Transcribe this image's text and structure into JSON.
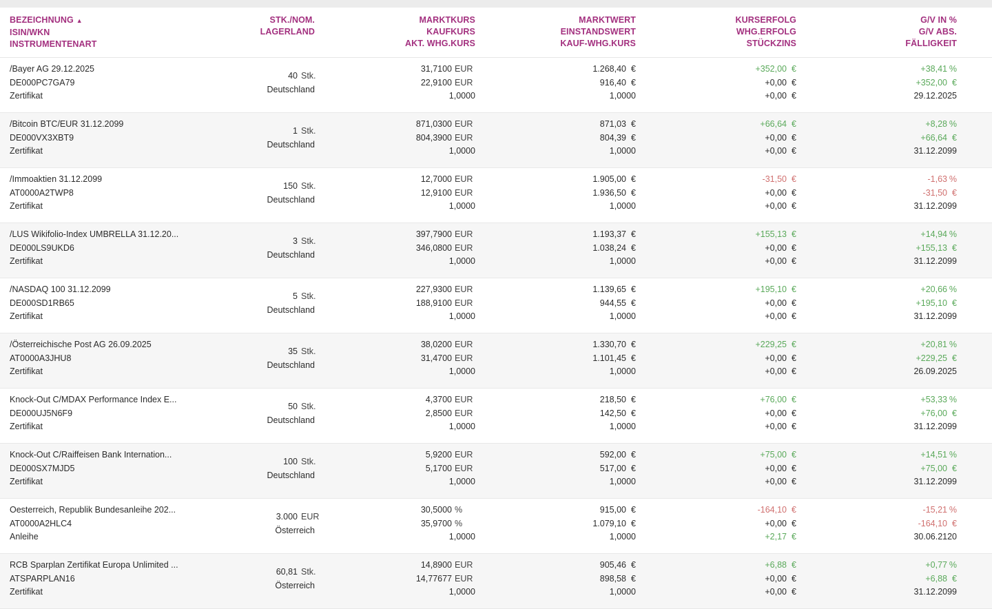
{
  "header": {
    "col1": [
      "BEZEICHNUNG",
      "ISIN/WKN",
      "INSTRUMENTENART"
    ],
    "col2": [
      "STK./NOM.",
      "LAGERLAND"
    ],
    "col3": [
      "MARKTKURS",
      "KAUFKURS",
      "AKT. WHG.KURS"
    ],
    "col4": [
      "MARKTWERT",
      "EINSTANDSWERT",
      "KAUF-WHG.KURS"
    ],
    "col5": [
      "KURSERFOLG",
      "WHG.ERFOLG",
      "STÜCKZINS"
    ],
    "col6": [
      "G/V IN %",
      "G/V ABS.",
      "FÄLLIGKEIT"
    ],
    "sort_icon": "sort-up-icon"
  },
  "colors": {
    "accent": "#a3307f",
    "positive": "#5aa95a",
    "negative": "#d0706f"
  },
  "rows": [
    {
      "name": "/Bayer AG 29.12.2025",
      "isin": "DE000PC7GA79",
      "type": "Zertifikat",
      "qty": "40",
      "qty_unit": "Stk.",
      "country": "Deutschland",
      "mkt": "31,7100",
      "mkt_unit": "EUR",
      "buy": "22,9100",
      "buy_unit": "EUR",
      "fx": "1,0000",
      "mval": "1.268,40",
      "cost": "916,40",
      "buyfx": "1,0000",
      "perf": "+352,00",
      "perf_sign": "pos",
      "fxperf": "+0,00",
      "accr": "+0,00",
      "accr_sign": "",
      "pct": "+38,41",
      "pct_sign": "pos",
      "abs": "+352,00",
      "abs_sign": "pos",
      "mat": "29.12.2025"
    },
    {
      "name": "/Bitcoin BTC/EUR 31.12.2099",
      "isin": "DE000VX3XBT9",
      "type": "Zertifikat",
      "qty": "1",
      "qty_unit": "Stk.",
      "country": "Deutschland",
      "mkt": "871,0300",
      "mkt_unit": "EUR",
      "buy": "804,3900",
      "buy_unit": "EUR",
      "fx": "1,0000",
      "mval": "871,03",
      "cost": "804,39",
      "buyfx": "1,0000",
      "perf": "+66,64",
      "perf_sign": "pos",
      "fxperf": "+0,00",
      "accr": "+0,00",
      "accr_sign": "",
      "pct": "+8,28",
      "pct_sign": "pos",
      "abs": "+66,64",
      "abs_sign": "pos",
      "mat": "31.12.2099"
    },
    {
      "name": "/Immoaktien 31.12.2099",
      "isin": "AT0000A2TWP8",
      "type": "Zertifikat",
      "qty": "150",
      "qty_unit": "Stk.",
      "country": "Deutschland",
      "mkt": "12,7000",
      "mkt_unit": "EUR",
      "buy": "12,9100",
      "buy_unit": "EUR",
      "fx": "1,0000",
      "mval": "1.905,00",
      "cost": "1.936,50",
      "buyfx": "1,0000",
      "perf": "-31,50",
      "perf_sign": "neg",
      "fxperf": "+0,00",
      "accr": "+0,00",
      "accr_sign": "",
      "pct": "-1,63",
      "pct_sign": "neg",
      "abs": "-31,50",
      "abs_sign": "neg",
      "mat": "31.12.2099"
    },
    {
      "name": "/LUS Wikifolio-Index UMBRELLA 31.12.20...",
      "isin": "DE000LS9UKD6",
      "type": "Zertifikat",
      "qty": "3",
      "qty_unit": "Stk.",
      "country": "Deutschland",
      "mkt": "397,7900",
      "mkt_unit": "EUR",
      "buy": "346,0800",
      "buy_unit": "EUR",
      "fx": "1,0000",
      "mval": "1.193,37",
      "cost": "1.038,24",
      "buyfx": "1,0000",
      "perf": "+155,13",
      "perf_sign": "pos",
      "fxperf": "+0,00",
      "accr": "+0,00",
      "accr_sign": "",
      "pct": "+14,94",
      "pct_sign": "pos",
      "abs": "+155,13",
      "abs_sign": "pos",
      "mat": "31.12.2099"
    },
    {
      "name": "/NASDAQ 100 31.12.2099",
      "isin": "DE000SD1RB65",
      "type": "Zertifikat",
      "qty": "5",
      "qty_unit": "Stk.",
      "country": "Deutschland",
      "mkt": "227,9300",
      "mkt_unit": "EUR",
      "buy": "188,9100",
      "buy_unit": "EUR",
      "fx": "1,0000",
      "mval": "1.139,65",
      "cost": "944,55",
      "buyfx": "1,0000",
      "perf": "+195,10",
      "perf_sign": "pos",
      "fxperf": "+0,00",
      "accr": "+0,00",
      "accr_sign": "",
      "pct": "+20,66",
      "pct_sign": "pos",
      "abs": "+195,10",
      "abs_sign": "pos",
      "mat": "31.12.2099"
    },
    {
      "name": "/Österreichische Post AG 26.09.2025",
      "isin": "AT0000A3JHU8",
      "type": "Zertifikat",
      "qty": "35",
      "qty_unit": "Stk.",
      "country": "Deutschland",
      "mkt": "38,0200",
      "mkt_unit": "EUR",
      "buy": "31,4700",
      "buy_unit": "EUR",
      "fx": "1,0000",
      "mval": "1.330,70",
      "cost": "1.101,45",
      "buyfx": "1,0000",
      "perf": "+229,25",
      "perf_sign": "pos",
      "fxperf": "+0,00",
      "accr": "+0,00",
      "accr_sign": "",
      "pct": "+20,81",
      "pct_sign": "pos",
      "abs": "+229,25",
      "abs_sign": "pos",
      "mat": "26.09.2025"
    },
    {
      "name": "Knock-Out C/MDAX Performance Index E...",
      "isin": "DE000UJ5N6F9",
      "type": "Zertifikat",
      "qty": "50",
      "qty_unit": "Stk.",
      "country": "Deutschland",
      "mkt": "4,3700",
      "mkt_unit": "EUR",
      "buy": "2,8500",
      "buy_unit": "EUR",
      "fx": "1,0000",
      "mval": "218,50",
      "cost": "142,50",
      "buyfx": "1,0000",
      "perf": "+76,00",
      "perf_sign": "pos",
      "fxperf": "+0,00",
      "accr": "+0,00",
      "accr_sign": "",
      "pct": "+53,33",
      "pct_sign": "pos",
      "abs": "+76,00",
      "abs_sign": "pos",
      "mat": "31.12.2099"
    },
    {
      "name": "Knock-Out C/Raiffeisen Bank Internation...",
      "isin": "DE000SX7MJD5",
      "type": "Zertifikat",
      "qty": "100",
      "qty_unit": "Stk.",
      "country": "Deutschland",
      "mkt": "5,9200",
      "mkt_unit": "EUR",
      "buy": "5,1700",
      "buy_unit": "EUR",
      "fx": "1,0000",
      "mval": "592,00",
      "cost": "517,00",
      "buyfx": "1,0000",
      "perf": "+75,00",
      "perf_sign": "pos",
      "fxperf": "+0,00",
      "accr": "+0,00",
      "accr_sign": "",
      "pct": "+14,51",
      "pct_sign": "pos",
      "abs": "+75,00",
      "abs_sign": "pos",
      "mat": "31.12.2099"
    },
    {
      "name": "Oesterreich, Republik Bundesanleihe 202...",
      "isin": "AT0000A2HLC4",
      "type": "Anleihe",
      "qty": "3.000",
      "qty_unit": "EUR",
      "country": "Österreich",
      "mkt": "30,5000",
      "mkt_unit": "%",
      "buy": "35,9700",
      "buy_unit": "%",
      "fx": "1,0000",
      "mval": "915,00",
      "cost": "1.079,10",
      "buyfx": "1,0000",
      "perf": "-164,10",
      "perf_sign": "neg",
      "fxperf": "+0,00",
      "accr": "+2,17",
      "accr_sign": "pos",
      "pct": "-15,21",
      "pct_sign": "neg",
      "abs": "-164,10",
      "abs_sign": "neg",
      "mat": "30.06.2120"
    },
    {
      "name": "RCB Sparplan Zertifikat Europa Unlimited ...",
      "isin": "ATSPARPLAN16",
      "type": "Zertifikat",
      "qty": "60,81",
      "qty_unit": "Stk.",
      "country": "Österreich",
      "mkt": "14,8900",
      "mkt_unit": "EUR",
      "buy": "14,77677",
      "buy_unit": "EUR",
      "fx": "1,0000",
      "mval": "905,46",
      "cost": "898,58",
      "buyfx": "1,0000",
      "perf": "+6,88",
      "perf_sign": "pos",
      "fxperf": "+0,00",
      "accr": "+0,00",
      "accr_sign": "",
      "pct": "+0,77",
      "pct_sign": "pos",
      "abs": "+6,88",
      "abs_sign": "pos",
      "mat": "31.12.2099"
    }
  ]
}
